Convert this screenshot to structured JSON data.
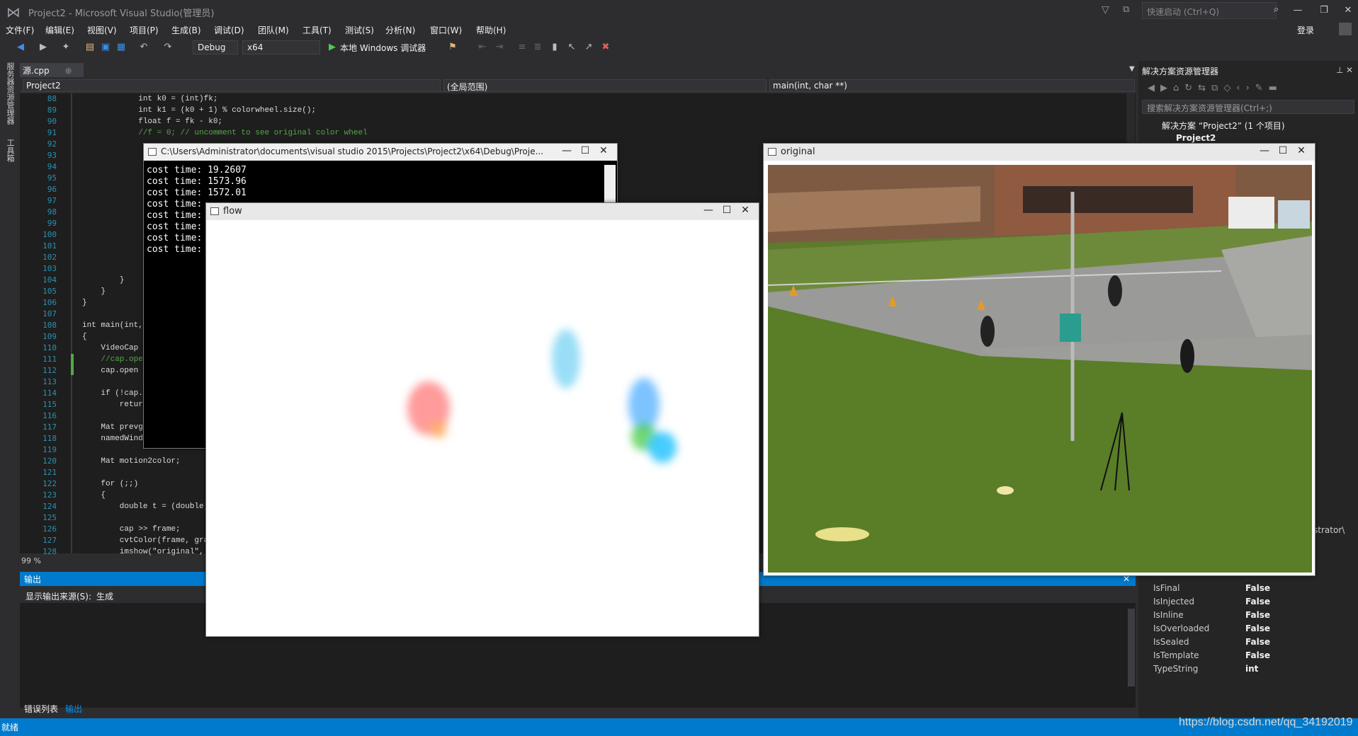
{
  "window": {
    "title": "Project2 - Microsoft Visual Studio(管理员)",
    "quick_launch_placeholder": "快速启动 (Ctrl+Q)",
    "login": "登录"
  },
  "menu": [
    "文件(F)",
    "编辑(E)",
    "视图(V)",
    "项目(P)",
    "生成(B)",
    "调试(D)",
    "团队(M)",
    "工具(T)",
    "测试(S)",
    "分析(N)",
    "窗口(W)",
    "帮助(H)"
  ],
  "toolbar": {
    "config": "Debug",
    "platform": "x64",
    "run_label": "本地 Windows 调试器"
  },
  "left_strip": {
    "server_explorer": "服务器资源管理器",
    "toolbox": "工具箱"
  },
  "editor": {
    "tab": "源.cpp",
    "project_combo": "Project2",
    "scope_combo": "(全局范围)",
    "member_combo": "main(int, char **)",
    "zoom": "99 %",
    "line_numbers": [
      "88",
      "89",
      "90",
      "91",
      "92",
      "93",
      "94",
      "95",
      "96",
      "97",
      "98",
      "99",
      "100",
      "101",
      "102",
      "103",
      "104",
      "105",
      "106",
      "107",
      "108",
      "109",
      "110",
      "111",
      "112",
      "113",
      "114",
      "115",
      "116",
      "117",
      "118",
      "119",
      "120",
      "121",
      "122",
      "123",
      "124",
      "125",
      "126",
      "127",
      "128"
    ],
    "code": [
      "            int k0 = (int)fk;",
      "            int k1 = (k0 + 1) % colorwheel.size();",
      "            float f = fk - k0;",
      "            //f = 0; // uncomment to see original color wheel",
      "",
      "",
      "",
      "",
      "",
      "",
      "",
      "",
      "",
      "",
      "",
      "",
      "        }",
      "    }",
      "}",
      "",
      "int main(int,",
      "{",
      "    VideoCap",
      "    //cap.ope",
      "    cap.open",
      "",
      "    if (!cap.",
      "        retur",
      "",
      "    Mat prevg",
      "    namedWind",
      "",
      "    Mat motion2color;",
      "",
      "    for (;;)",
      "    {",
      "        double t = (double)",
      "",
      "        cap >> frame;",
      "        cvtColor(frame, gra",
      "        imshow(\"original\","
    ]
  },
  "output": {
    "header": "输出",
    "source_label": "显示输出来源(S):",
    "source_value": "生成",
    "tabs": [
      "错误列表",
      "输出"
    ]
  },
  "solution_explorer": {
    "title": "解决方案资源管理器",
    "search_placeholder": "搜索解决方案资源管理器(Ctrl+;)",
    "root": "解决方案 “Project2” (1 个项目)",
    "project": "Project2",
    "truncated_text": "strator\\"
  },
  "properties": [
    {
      "name": "IsFinal",
      "value": "False"
    },
    {
      "name": "IsInjected",
      "value": "False"
    },
    {
      "name": "IsInline",
      "value": "False"
    },
    {
      "name": "IsOverloaded",
      "value": "False"
    },
    {
      "name": "IsSealed",
      "value": "False"
    },
    {
      "name": "IsTemplate",
      "value": "False"
    },
    {
      "name": "TypeString",
      "value": "int"
    }
  ],
  "console": {
    "title": "C:\\Users\\Administrator\\documents\\visual studio 2015\\Projects\\Project2\\x64\\Debug\\Proje...",
    "lines": [
      "cost time: 19.2607",
      "cost time: 1573.96",
      "cost time: 1572.01",
      "cost time:",
      "cost time:",
      "cost time:",
      "cost time:",
      "cost time:"
    ]
  },
  "flow_window": {
    "title": "flow"
  },
  "original_window": {
    "title": "original"
  },
  "status": {
    "text": "就绪"
  },
  "watermark": "https://blog.csdn.net/qq_34192019"
}
